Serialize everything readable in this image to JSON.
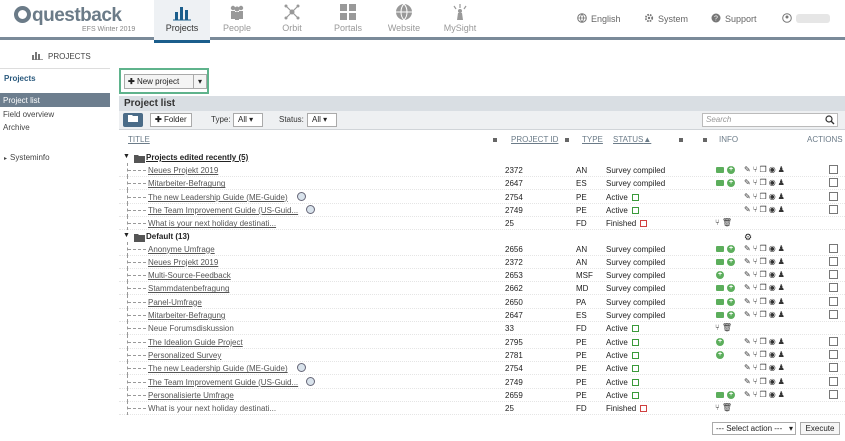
{
  "header": {
    "brand": "questback",
    "version": "EFS Winter 2019",
    "nav": [
      {
        "label": "Projects",
        "icon": "bar-chart-icon",
        "active": true
      },
      {
        "label": "People",
        "icon": "people-icon",
        "active": false
      },
      {
        "label": "Orbit",
        "icon": "orbit-icon",
        "active": false
      },
      {
        "label": "Portals",
        "icon": "grid-icon",
        "active": false
      },
      {
        "label": "Website",
        "icon": "globe-icon",
        "active": false
      },
      {
        "label": "MySight",
        "icon": "mysight-icon",
        "active": false
      }
    ],
    "language": "English",
    "system": "System",
    "support": "Support"
  },
  "breadcrumb": {
    "label": "PROJECTS"
  },
  "sidebar": {
    "heading": "Projects",
    "items": [
      "Project list",
      "Field overview",
      "Archive"
    ],
    "selected": "Project list",
    "sysinfo": "Systeminfo"
  },
  "toolbar": {
    "new_project": "New project"
  },
  "list": {
    "title": "Project list",
    "folder_button": "Folder",
    "type_label": "Type:",
    "type_value": "All",
    "status_label": "Status:",
    "status_value": "All",
    "search_placeholder": "Search"
  },
  "columns": {
    "title": "TITLE",
    "project_id": "PROJECT ID",
    "type": "TYPE",
    "status": "STATUS",
    "info": "INFO",
    "actions": "ACTIONS"
  },
  "groups": [
    {
      "label": "Projects edited recently (5)",
      "rows": [
        {
          "title": "Neues Projekt 2019",
          "id": "2372",
          "type": "AN",
          "status": "Survey compiled",
          "info": "lock-plus",
          "actions": true
        },
        {
          "title": "Mitarbeiter-Befragung",
          "id": "2647",
          "type": "ES",
          "status": "Survey compiled",
          "info": "lock-plus",
          "actions": true
        },
        {
          "title": "The new Leadership Guide (ME-Guide)",
          "id": "2754",
          "type": "PE",
          "status": "Active",
          "cal": "green",
          "globe": true,
          "actions": true
        },
        {
          "title": "The Team Improvement Guide (US-Guid...",
          "id": "2749",
          "type": "PE",
          "status": "Active",
          "cal": "green",
          "globe": true,
          "actions": true
        },
        {
          "title": "What is your next holiday destinati...",
          "id": "25",
          "type": "FD",
          "status": "Finished",
          "cal": "red",
          "forum": true
        }
      ]
    },
    {
      "label": "Default (13)",
      "rows": [
        {
          "title": "Anonyme Umfrage",
          "id": "2656",
          "type": "AN",
          "status": "Survey compiled",
          "info": "lock-plus",
          "actions": true
        },
        {
          "title": "Neues Projekt 2019",
          "id": "2372",
          "type": "AN",
          "status": "Survey compiled",
          "info": "lock-plus",
          "actions": true
        },
        {
          "title": "Multi-Source-Feedback",
          "id": "2653",
          "type": "MSF",
          "status": "Survey compiled",
          "info": "plus",
          "actions": true
        },
        {
          "title": "Stammdatenbefragung",
          "id": "2662",
          "type": "MD",
          "status": "Survey compiled",
          "info": "lock-plus",
          "actions": true
        },
        {
          "title": "Panel-Umfrage",
          "id": "2650",
          "type": "PA",
          "status": "Survey compiled",
          "info": "lock-plus",
          "actions": true
        },
        {
          "title": "Mitarbeiter-Befragung",
          "id": "2647",
          "type": "ES",
          "status": "Survey compiled",
          "info": "lock-plus",
          "actions": true
        },
        {
          "title": "Neue Forumsdiskussion",
          "id": "33",
          "type": "FD",
          "status": "Active",
          "cal": "green",
          "forum": true,
          "plain": true
        },
        {
          "title": "The Idealion Guide Project",
          "id": "2795",
          "type": "PE",
          "status": "Active",
          "cal": "green",
          "info": "plus",
          "actions": true
        },
        {
          "title": "Personalized Survey",
          "id": "2781",
          "type": "PE",
          "status": "Active",
          "cal": "green",
          "info": "plus",
          "actions": true
        },
        {
          "title": "The new Leadership Guide (ME-Guide)",
          "id": "2754",
          "type": "PE",
          "status": "Active",
          "cal": "green",
          "globe": true,
          "actions": true
        },
        {
          "title": "The Team Improvement Guide (US-Guid...",
          "id": "2749",
          "type": "PE",
          "status": "Active",
          "cal": "green",
          "globe": true,
          "actions": true
        },
        {
          "title": "Personalisierte Umfrage",
          "id": "2659",
          "type": "PE",
          "status": "Active",
          "cal": "green",
          "info": "lock-plus",
          "actions": true
        },
        {
          "title": "What is your next holiday destinati...",
          "id": "25",
          "type": "FD",
          "status": "Finished",
          "cal": "red",
          "forum": true,
          "plain": true
        }
      ]
    }
  ],
  "footer": {
    "select_action": "--- Select action ---",
    "execute": "Execute"
  }
}
